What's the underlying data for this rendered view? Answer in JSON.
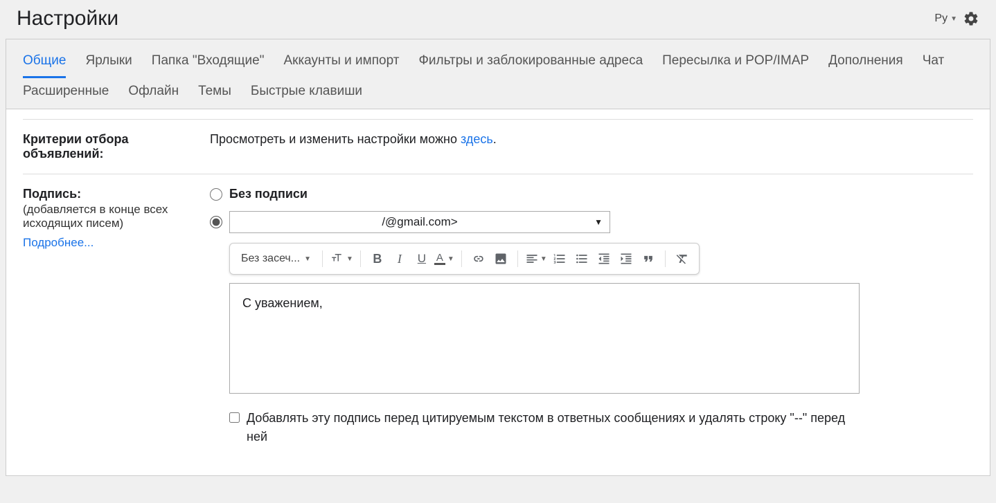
{
  "header": {
    "title": "Настройки",
    "language": "Ру"
  },
  "tabs": [
    {
      "label": "Общие",
      "active": true
    },
    {
      "label": "Ярлыки"
    },
    {
      "label": "Папка \"Входящие\""
    },
    {
      "label": "Аккаунты и импорт"
    },
    {
      "label": "Фильтры и заблокированные адреса"
    },
    {
      "label": "Пересылка и POP/IMAP"
    },
    {
      "label": "Дополнения"
    },
    {
      "label": "Чат"
    },
    {
      "label": "Расширенные"
    },
    {
      "label": "Офлайн"
    },
    {
      "label": "Темы"
    },
    {
      "label": "Быстрые клавиши"
    }
  ],
  "rows": {
    "ads": {
      "title": "Критерии отбора объявлений:",
      "value_prefix": "Просмотреть и изменить настройки можно ",
      "link": "здесь",
      "suffix": "."
    },
    "signature": {
      "title": "Подпись:",
      "subtitle": "(добавляется в конце всех исходящих писем)",
      "learn_more": "Подробнее...",
      "no_signature_label": "Без подписи",
      "selected_account": "/@gmail.com>",
      "font_selector": "Без засеч...",
      "editor_content": "С уважением,",
      "checkbox_label": "Добавлять эту подпись перед цитируемым текстом в ответных сообщениях и удалять строку \"--\" перед ней"
    }
  }
}
